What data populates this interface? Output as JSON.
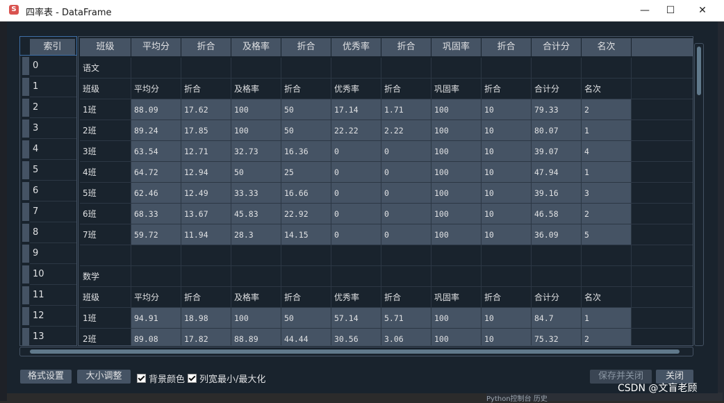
{
  "window": {
    "title": "四率表 - DataFrame",
    "icon": "app-logo-icon",
    "controls": {
      "minimize": "—",
      "maximize": "☐",
      "close": "✕"
    }
  },
  "table": {
    "index_header": "索引",
    "columns": [
      "班级",
      "平均分",
      "折合",
      "及格率",
      "折合",
      "优秀率",
      "折合",
      "巩固率",
      "折合",
      "合计分",
      "名次"
    ],
    "index": [
      "0",
      "1",
      "2",
      "3",
      "4",
      "5",
      "6",
      "7",
      "8",
      "9",
      "10",
      "11",
      "12",
      "13"
    ],
    "rows": [
      [
        "语文",
        "",
        "",
        "",
        "",
        "",
        "",
        "",
        "",
        "",
        "",
        ""
      ],
      [
        "班级",
        "平均分",
        "折合",
        "及格率",
        "折合",
        "优秀率",
        "折合",
        "巩固率",
        "折合",
        "合计分",
        "名次",
        ""
      ],
      [
        "1班",
        "88.09",
        "17.62",
        "100",
        "50",
        "17.14",
        "1.71",
        "100",
        "10",
        "79.33",
        "2",
        ""
      ],
      [
        "2班",
        "89.24",
        "17.85",
        "100",
        "50",
        "22.22",
        "2.22",
        "100",
        "10",
        "80.07",
        "1",
        ""
      ],
      [
        "3班",
        "63.54",
        "12.71",
        "32.73",
        "16.36",
        "0",
        "0",
        "100",
        "10",
        "39.07",
        "4",
        ""
      ],
      [
        "4班",
        "64.72",
        "12.94",
        "50",
        "25",
        "0",
        "0",
        "100",
        "10",
        "47.94",
        "1",
        ""
      ],
      [
        "5班",
        "62.46",
        "12.49",
        "33.33",
        "16.66",
        "0",
        "0",
        "100",
        "10",
        "39.16",
        "3",
        ""
      ],
      [
        "6班",
        "68.33",
        "13.67",
        "45.83",
        "22.92",
        "0",
        "0",
        "100",
        "10",
        "46.58",
        "2",
        ""
      ],
      [
        "7班",
        "59.72",
        "11.94",
        "28.3",
        "14.15",
        "0",
        "0",
        "100",
        "10",
        "36.09",
        "5",
        ""
      ],
      [
        "",
        "",
        "",
        "",
        "",
        "",
        "",
        "",
        "",
        "",
        "",
        ""
      ],
      [
        "数学",
        "",
        "",
        "",
        "",
        "",
        "",
        "",
        "",
        "",
        "",
        ""
      ],
      [
        "班级",
        "平均分",
        "折合",
        "及格率",
        "折合",
        "优秀率",
        "折合",
        "巩固率",
        "折合",
        "合计分",
        "名次",
        ""
      ],
      [
        "1班",
        "94.91",
        "18.98",
        "100",
        "50",
        "57.14",
        "5.71",
        "100",
        "10",
        "84.7",
        "1",
        ""
      ],
      [
        "2班",
        "89.08",
        "17.82",
        "88.89",
        "44.44",
        "30.56",
        "3.06",
        "100",
        "10",
        "75.32",
        "2",
        ""
      ]
    ]
  },
  "footer": {
    "format_button": "格式设置",
    "resize_button": "大小调整",
    "bg_color_checkbox": "背景颜色",
    "col_width_checkbox": "列宽最小/最大化",
    "bg_color_checked": true,
    "col_width_checked": true,
    "save_close_button": "保存并关闭",
    "close_button": "关闭"
  },
  "background": {
    "ide_tab": "Python控制台  历史"
  },
  "watermark": "CSDN @文盲老顾",
  "colors": {
    "dialog_bg": "#19232d",
    "cell_light": "#455364",
    "text": "#e0e1e3",
    "accent": "#3e6fa6"
  }
}
